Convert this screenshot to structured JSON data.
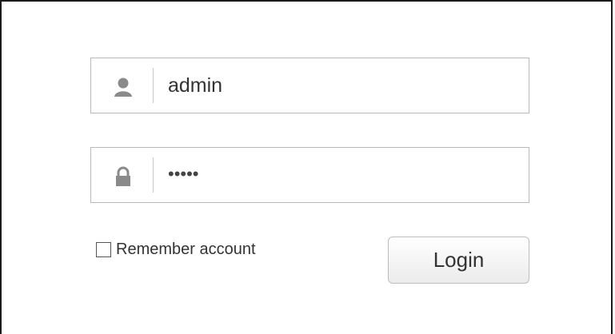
{
  "login_form": {
    "username": {
      "value": "admin",
      "icon": "user-icon"
    },
    "password": {
      "masked_value": "•••••",
      "icon": "lock-icon"
    },
    "remember": {
      "label": "Remember account",
      "checked": false
    },
    "login_button": {
      "label": "Login"
    }
  },
  "colors": {
    "border": "#b9b9b9",
    "icon": "#8a8a8a",
    "text": "#333333",
    "frame": "#1a1a1a"
  }
}
